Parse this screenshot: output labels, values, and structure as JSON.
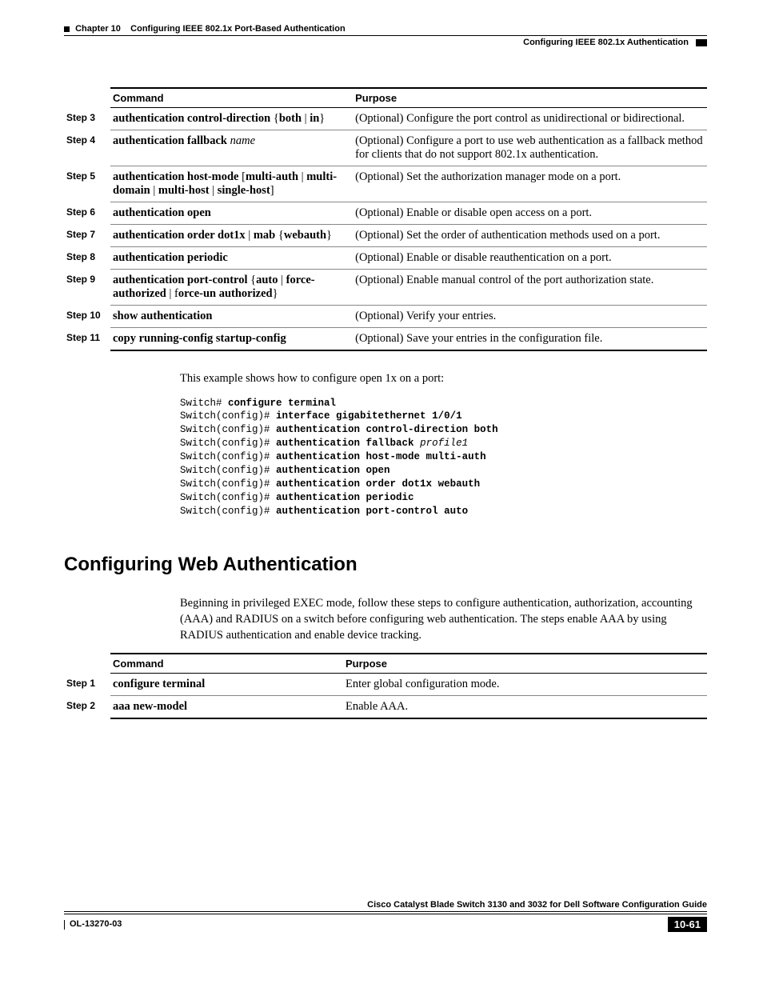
{
  "header": {
    "chapter": "Chapter 10",
    "title": "Configuring IEEE 802.1x Port-Based Authentication",
    "section": "Configuring IEEE 802.1x Authentication"
  },
  "table1": {
    "headers": {
      "command": "Command",
      "purpose": "Purpose"
    },
    "rows": [
      {
        "step": "Step 3",
        "cmd_bold": "authentication control-direction ",
        "cmd_plain": "{",
        "cmd_bold2": "both",
        "cmd_sep": " | ",
        "cmd_bold3": "in",
        "cmd_plain2": "}",
        "purpose": "(Optional) Configure the port control as unidirectional or bidirectional."
      },
      {
        "step": "Step 4",
        "cmd_bold": "authentication fallback ",
        "cmd_italic": "name",
        "purpose": "(Optional) Configure a port to use web authentication as a fallback method for clients that do not support 802.1x authentication."
      },
      {
        "step": "Step 5",
        "cmd_bold": "authentication host-mode ",
        "cmd_plain": "[",
        "cmd_bold2": "multi-auth",
        "cmd_sep": " | ",
        "cmd_bold3": "multi-domain",
        "cmd_sep2": " | ",
        "cmd_bold4": "multi-host",
        "cmd_sep3": " | ",
        "cmd_bold5": "single-host",
        "cmd_plain2": "]",
        "purpose": "(Optional) Set the authorization manager mode on a port."
      },
      {
        "step": "Step 6",
        "cmd_bold": "authentication open",
        "purpose": "(Optional) Enable or disable open access on a port."
      },
      {
        "step": "Step 7",
        "cmd_bold": "authentication order dot1x",
        "cmd_sep": " | ",
        "cmd_bold2": "mab",
        "cmd_plain": " {",
        "cmd_bold3": "webauth",
        "cmd_plain2": "}",
        "purpose": "(Optional) Set the order of authentication methods used on a port."
      },
      {
        "step": "Step 8",
        "cmd_bold": "authentication periodic",
        "purpose": "(Optional) Enable or disable reauthentication on a port."
      },
      {
        "step": "Step 9",
        "cmd_bold": "authentication port-control ",
        "cmd_plain": "{",
        "cmd_bold2": "auto",
        "cmd_sep": " | ",
        "cmd_bold3": "force-authorized",
        "cmd_sep2": " | f",
        "cmd_bold4": "orce-un authorized",
        "cmd_plain2": "}",
        "purpose": "(Optional) Enable manual control of the port authorization state."
      },
      {
        "step": "Step 10",
        "cmd_bold": "show authentication",
        "purpose": "(Optional) Verify your entries."
      },
      {
        "step": "Step 11",
        "cmd_bold": "copy running-config startup-config",
        "purpose": "(Optional) Save your entries in the configuration file."
      }
    ]
  },
  "example_intro": "This example shows how to configure open 1x on a port:",
  "code": [
    {
      "p1": "Switch# ",
      "b1": "configure terminal"
    },
    {
      "p1": "Switch(config)# ",
      "b1": "interface gigabitethernet 1/0/1"
    },
    {
      "p1": "Switch(config)# ",
      "b1": "authentication control-direction both"
    },
    {
      "p1": "Switch(config)# ",
      "b1": "authentication fallback ",
      "i1": "profile1"
    },
    {
      "p1": "Switch(config)# ",
      "b1": "authentication host-mode multi-auth"
    },
    {
      "p1": "Switch(config)# ",
      "b1": "authentication open"
    },
    {
      "p1": "Switch(config)# ",
      "b1": "authentication order dot1x webauth"
    },
    {
      "p1": "Switch(config)# ",
      "b1": "authentication periodic"
    },
    {
      "p1": "Switch(config)# ",
      "b1": "authentication port-control auto"
    }
  ],
  "section2": {
    "heading": "Configuring Web Authentication",
    "intro": "Beginning in privileged EXEC mode, follow these steps to configure authentication, authorization, accounting (AAA) and RADIUS on a switch before configuring web authentication. The steps enable AAA by using RADIUS authentication and enable device tracking."
  },
  "table2": {
    "headers": {
      "command": "Command",
      "purpose": "Purpose"
    },
    "rows": [
      {
        "step": "Step 1",
        "cmd_bold": "configure terminal",
        "purpose": "Enter global configuration mode."
      },
      {
        "step": "Step 2",
        "cmd_bold": "aaa new-model",
        "purpose": "Enable AAA."
      }
    ]
  },
  "footer": {
    "guide": "Cisco Catalyst Blade Switch 3130 and 3032 for Dell Software Configuration Guide",
    "docid": "OL-13270-03",
    "page": "10-61"
  }
}
